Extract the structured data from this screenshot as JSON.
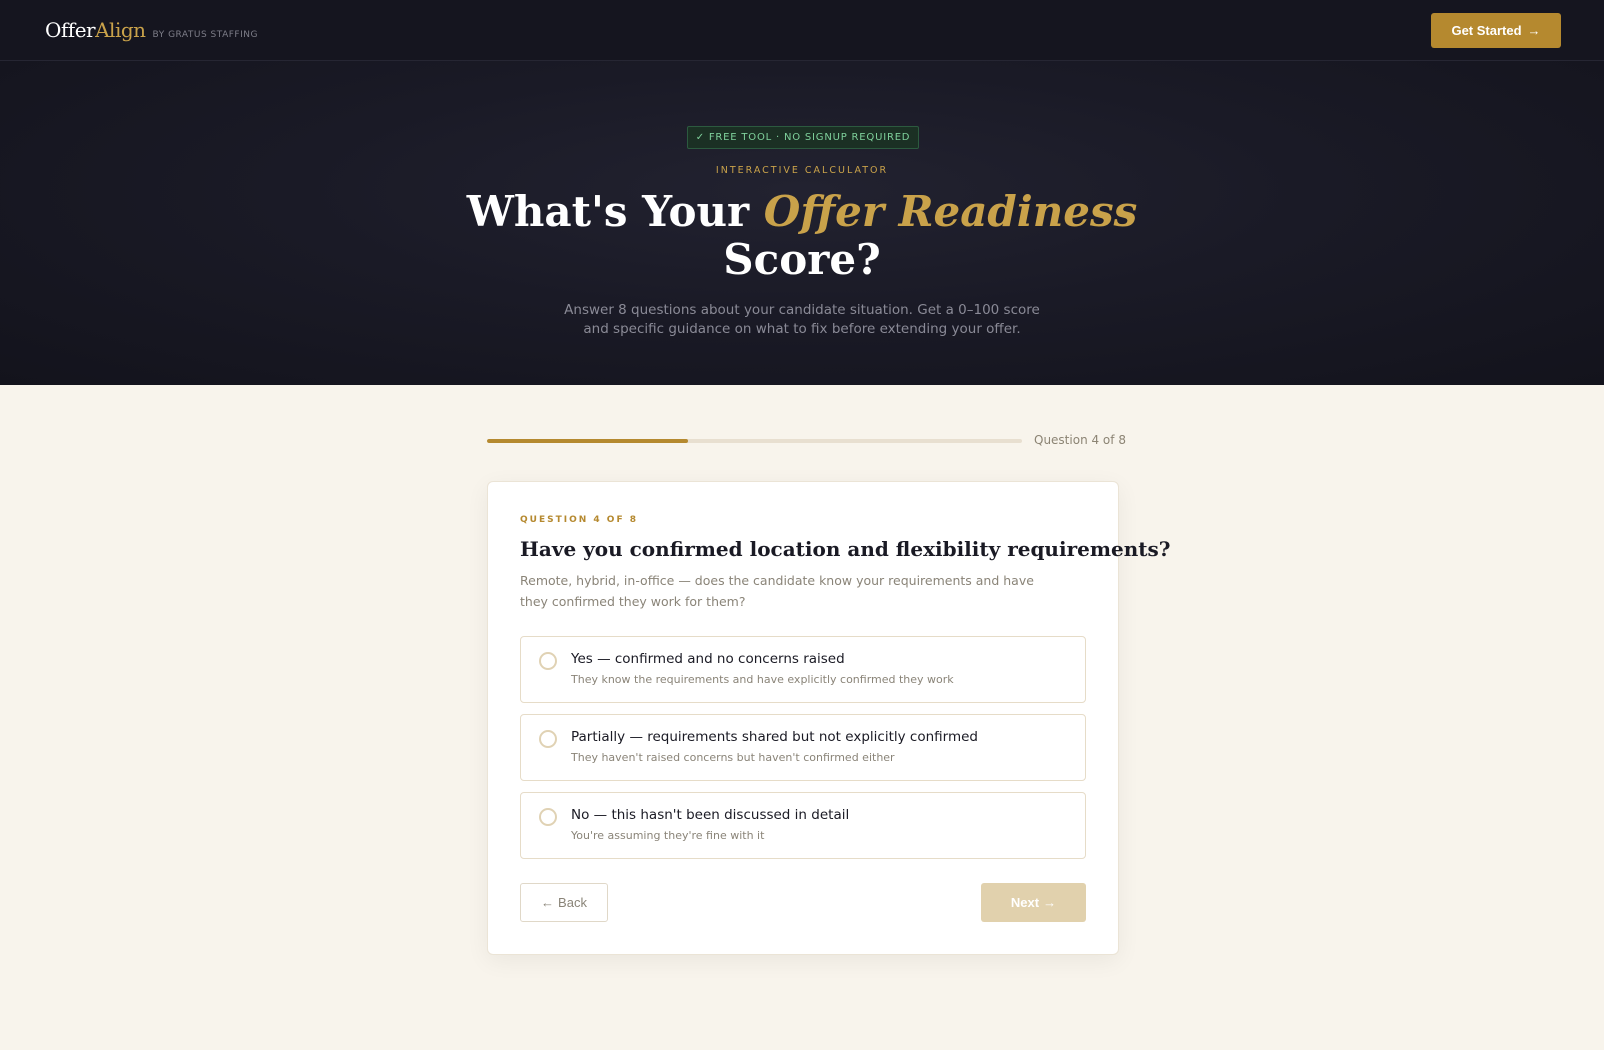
{
  "nav": {
    "logo_offer": "Offer",
    "logo_align": "Align",
    "logo_by": "BY GRATUS STAFFING",
    "cta_label": "Get Started",
    "cta_arrow": "→"
  },
  "hero": {
    "badge_check": "✓",
    "badge_text": "FREE TOOL · NO SIGNUP REQUIRED",
    "eyebrow": "INTERACTIVE CALCULATOR",
    "title_pre": "What's Your ",
    "title_accent": "Offer Readiness",
    "title_post": "Score?",
    "subtitle": "Answer 8 questions about your candidate situation. Get a 0–100 score and specific guidance on what to fix before extending your offer."
  },
  "progress": {
    "current": 4,
    "total": 8,
    "fraction": 0.375,
    "label": "Question 4 of 8"
  },
  "question": {
    "eyebrow": "QUESTION 4 OF 8",
    "title": "Have you confirmed location and flexibility requirements?",
    "description": "Remote, hybrid, in-office — does the candidate know your requirements and have they confirmed they work for them?",
    "options": [
      {
        "label": "Yes — confirmed and no concerns raised",
        "sub": "They know the requirements and have explicitly confirmed they work"
      },
      {
        "label": "Partially — requirements shared but not explicitly confirmed",
        "sub": "They haven't raised concerns but haven't confirmed either"
      },
      {
        "label": "No — this hasn't been discussed in detail",
        "sub": "You're assuming they're fine with it"
      }
    ]
  },
  "actions": {
    "back_arrow": "←",
    "back_label": "Back",
    "next_label": "Next",
    "next_arrow": "→"
  },
  "colors": {
    "accent": "#b5892f",
    "accent_light": "#c9a24a",
    "nav_bg": "#15151f",
    "page_bg": "#f8f4ec",
    "badge_green": "#7fd19c",
    "next_disabled": "#e1d1ad"
  }
}
